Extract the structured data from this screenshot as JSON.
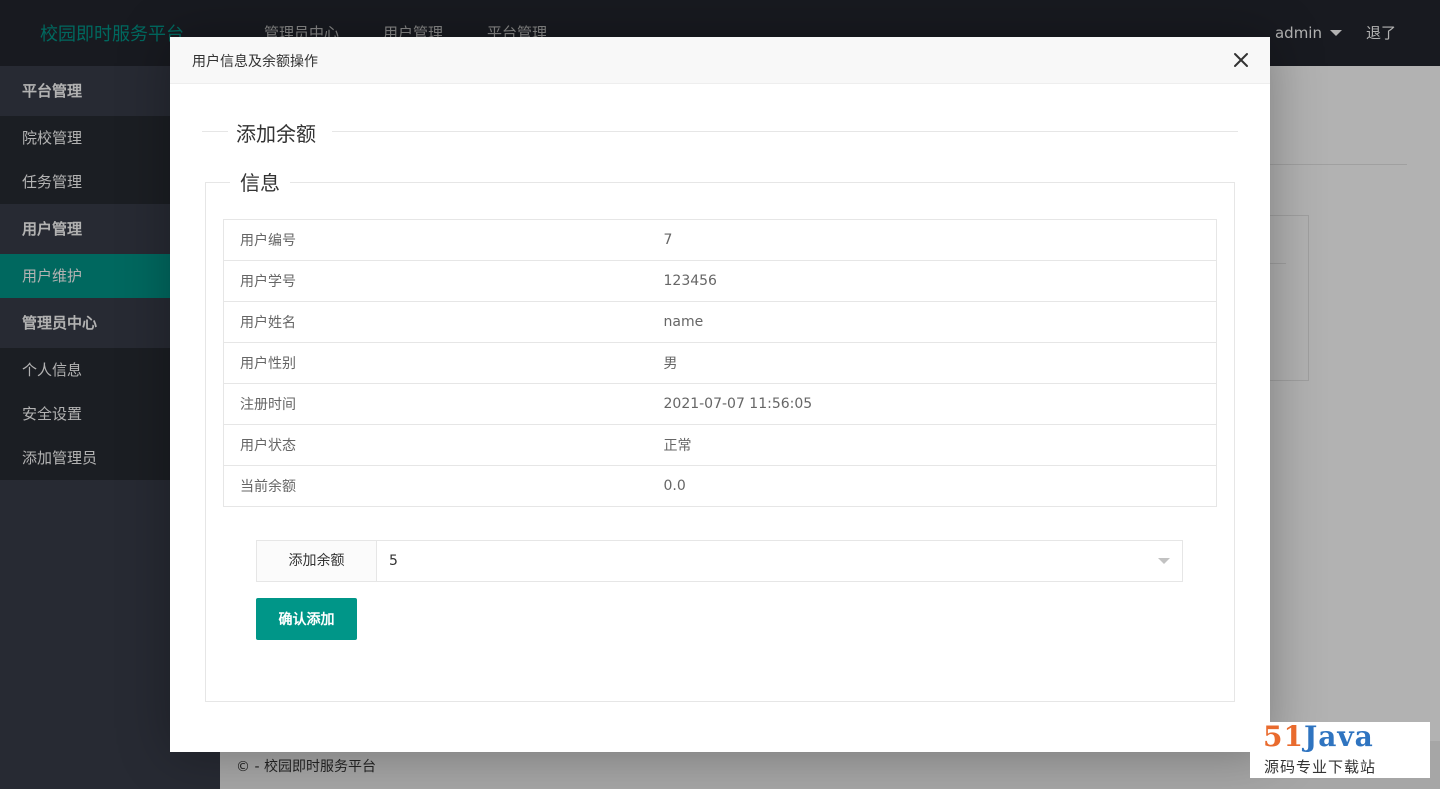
{
  "header": {
    "logo": "校园即时服务平台",
    "nav": [
      "管理员中心",
      "用户管理",
      "平台管理"
    ],
    "user": "admin",
    "logout": "退了"
  },
  "sidebar": {
    "groups": [
      {
        "title": "平台管理",
        "items": [
          "院校管理",
          "任务管理"
        ]
      },
      {
        "title": "用户管理",
        "items": [
          "用户维护"
        ]
      },
      {
        "title": "管理员中心",
        "items": [
          "个人信息",
          "安全设置",
          "添加管理员"
        ]
      }
    ],
    "active": "用户维护"
  },
  "footer": {
    "text": "© - 校园即时服务平台"
  },
  "modal": {
    "title": "用户信息及余额操作",
    "section_title": "添加余额",
    "fieldset_legend": "信息",
    "rows": [
      {
        "label": "用户编号",
        "value": "7"
      },
      {
        "label": "用户学号",
        "value": "123456"
      },
      {
        "label": "用户姓名",
        "value": "name"
      },
      {
        "label": "用户性别",
        "value": "男"
      },
      {
        "label": "注册时间",
        "value": "2021-07-07 11:56:05"
      },
      {
        "label": "用户状态",
        "value": "正常"
      },
      {
        "label": "当前余额",
        "value": "0.0"
      }
    ],
    "amount_label": "添加余额",
    "amount_value": "5",
    "confirm_label": "确认添加"
  },
  "watermark": {
    "num": "51",
    "brand": "Java",
    "tagline": "源码专业下载站"
  },
  "colors": {
    "accent": "#009688",
    "header_bg": "#23262e",
    "sidebar_bg": "#393d49"
  }
}
